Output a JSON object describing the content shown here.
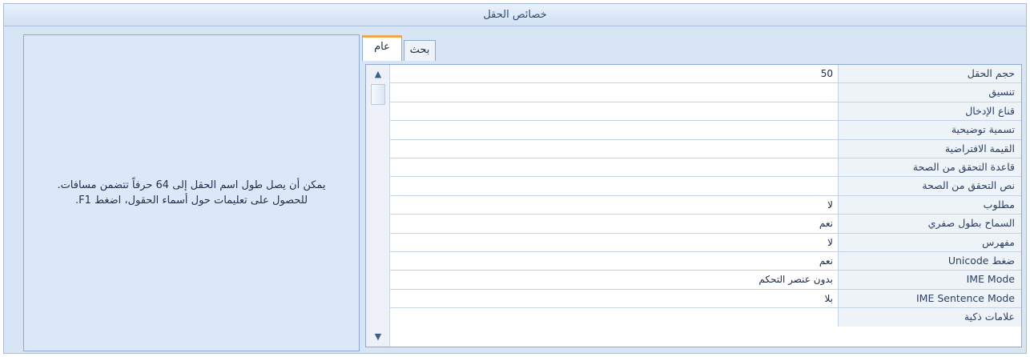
{
  "panel": {
    "title": "خصائص الحقل"
  },
  "tabs": [
    {
      "label": "عام",
      "selected": true
    },
    {
      "label": "بحث",
      "selected": false
    }
  ],
  "properties": [
    {
      "label": "حجم الحقل",
      "value": "50"
    },
    {
      "label": "تنسيق",
      "value": ""
    },
    {
      "label": "قناع الإدخال",
      "value": ""
    },
    {
      "label": "تسمية توضيحية",
      "value": ""
    },
    {
      "label": "القيمة الافتراضية",
      "value": ""
    },
    {
      "label": "قاعدة التحقق من الصحة",
      "value": ""
    },
    {
      "label": "نص التحقق من الصحة",
      "value": ""
    },
    {
      "label": "مطلوب",
      "value": "لا"
    },
    {
      "label": "السماح بطول صفري",
      "value": "نعم"
    },
    {
      "label": "مفهرس",
      "value": "لا"
    },
    {
      "label": "ضغط Unicode",
      "value": "نعم"
    },
    {
      "label": "IME Mode",
      "value": "بدون عنصر التحكم"
    },
    {
      "label": "IME Sentence Mode",
      "value": "بلا"
    },
    {
      "label": "علامات ذكية",
      "value": ""
    }
  ],
  "help": {
    "text": "يمكن أن يصل طول اسم الحقل إلى 64 حرفاً تتضمن مسافات. للحصول على تعليمات حول أسماء الحقول، اضغط F1."
  },
  "icons": {
    "scroll_up": "chevron-up-icon",
    "scroll_down": "chevron-down-icon"
  },
  "colors": {
    "panel_background": "#d8e5f5",
    "active_tab_accent": "#f2a64a",
    "border": "#8ea9cf"
  }
}
